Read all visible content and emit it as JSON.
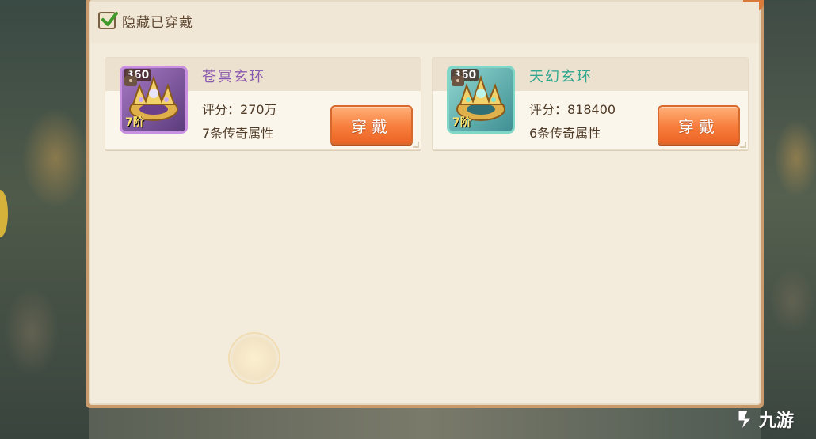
{
  "filter": {
    "hide_equipped_label": "隐藏已穿戴",
    "hide_equipped_checked": true
  },
  "items": [
    {
      "name": "苍冥玄环",
      "level": "360",
      "tier": "7阶",
      "score_label": "评分：",
      "score_value": "270万",
      "legend_attrs": "7条传奇属性",
      "button_label": "穿戴",
      "name_color": "#8b5bb0",
      "icon": "golden-ring-purple-icon"
    },
    {
      "name": "天幻玄环",
      "level": "360",
      "tier": "7阶",
      "score_label": "评分：",
      "score_value": "818400",
      "legend_attrs": "6条传奇属性",
      "button_label": "穿戴",
      "name_color": "#2fa78f",
      "icon": "golden-ring-teal-icon"
    }
  ],
  "watermark": {
    "text": "九游",
    "icon": "jiuyou-logo-icon"
  }
}
